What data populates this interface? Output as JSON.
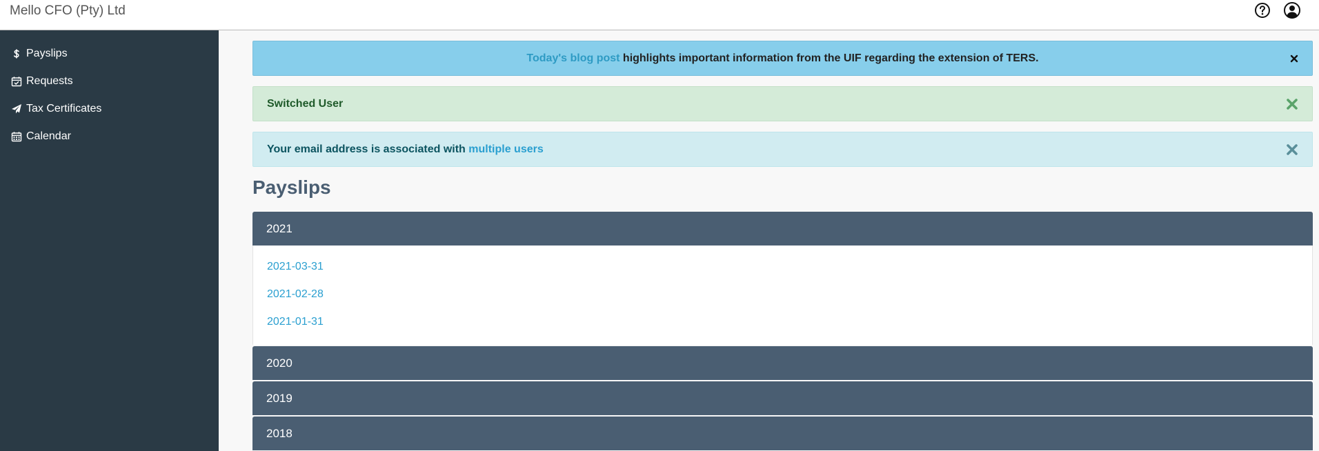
{
  "header": {
    "brand": "Mello CFO (Pty) Ltd",
    "icons": [
      "question-circle-icon",
      "user-circle-icon"
    ]
  },
  "sidebar": {
    "items": [
      {
        "label": "Payslips",
        "icon": "dollar-icon"
      },
      {
        "label": "Requests",
        "icon": "calendar-check-icon"
      },
      {
        "label": "Tax Certificates",
        "icon": "paper-plane-icon"
      },
      {
        "label": "Calendar",
        "icon": "calendar-icon"
      }
    ]
  },
  "alerts": {
    "blog": {
      "link_text": "Today's blog post",
      "text": " highlights important information from the UIF regarding the extension of TERS."
    },
    "switched": {
      "text": "Switched User"
    },
    "email": {
      "text": "Your email address is associated with ",
      "link_text": "multiple users"
    }
  },
  "main": {
    "title": "Payslips",
    "years": [
      {
        "label": "2021",
        "expanded": true,
        "payslips": [
          "2021-03-31",
          "2021-02-28",
          "2021-01-31"
        ]
      },
      {
        "label": "2020",
        "expanded": false
      },
      {
        "label": "2019",
        "expanded": false
      },
      {
        "label": "2018",
        "expanded": false
      }
    ]
  },
  "colors": {
    "sidebar_bg": "#2a3a45",
    "accordion_header": "#4a5e72",
    "link": "#2a9fd0",
    "alert_blue": "#87ceeb",
    "alert_green": "#d4ebd8",
    "alert_info": "#d1ecf1"
  }
}
